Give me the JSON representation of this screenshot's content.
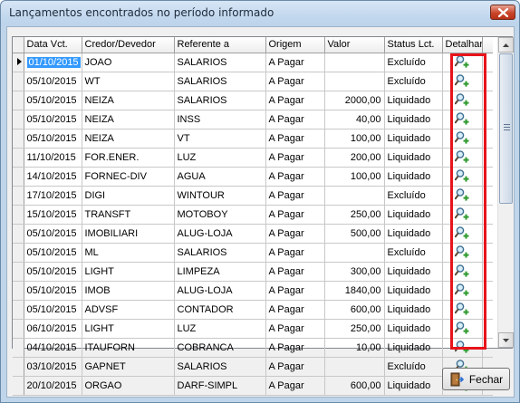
{
  "window": {
    "title": "Lançamentos encontrados no período informado",
    "close_icon": "close-icon"
  },
  "grid": {
    "columns": [
      "Data Vct.",
      "Credor/Devedor",
      "Referente a",
      "Origem",
      "Valor",
      "Status Lct.",
      "Detalhar"
    ],
    "detail_icon": "magnifier-plus-icon",
    "rows": [
      {
        "date": "01/10/2015",
        "creditor": "JOAO",
        "reference": "SALARIOS",
        "origin": "A Pagar",
        "value": "",
        "status": "Excluído"
      },
      {
        "date": "05/10/2015",
        "creditor": "WT",
        "reference": "SALARIOS",
        "origin": "A Pagar",
        "value": "",
        "status": "Excluído"
      },
      {
        "date": "05/10/2015",
        "creditor": "NEIZA",
        "reference": "SALARIOS",
        "origin": "A Pagar",
        "value": "2000,00",
        "status": "Liquidado"
      },
      {
        "date": "05/10/2015",
        "creditor": "NEIZA",
        "reference": "INSS",
        "origin": "A Pagar",
        "value": "40,00",
        "status": "Liquidado"
      },
      {
        "date": "05/10/2015",
        "creditor": "NEIZA",
        "reference": "VT",
        "origin": "A Pagar",
        "value": "100,00",
        "status": "Liquidado"
      },
      {
        "date": "11/10/2015",
        "creditor": "FOR.ENER.",
        "reference": "LUZ",
        "origin": "A Pagar",
        "value": "200,00",
        "status": "Liquidado"
      },
      {
        "date": "14/10/2015",
        "creditor": "FORNEC-DIV",
        "reference": "AGUA",
        "origin": "A Pagar",
        "value": "100,00",
        "status": "Liquidado"
      },
      {
        "date": "17/10/2015",
        "creditor": "DIGI",
        "reference": "WINTOUR",
        "origin": "A Pagar",
        "value": "",
        "status": "Excluído"
      },
      {
        "date": "15/10/2015",
        "creditor": "TRANSFT",
        "reference": "MOTOBOY",
        "origin": "A Pagar",
        "value": "250,00",
        "status": "Liquidado"
      },
      {
        "date": "05/10/2015",
        "creditor": "IMOBILIARI",
        "reference": "ALUG-LOJA",
        "origin": "A Pagar",
        "value": "500,00",
        "status": "Liquidado"
      },
      {
        "date": "05/10/2015",
        "creditor": "ML",
        "reference": "SALARIOS",
        "origin": "A Pagar",
        "value": "",
        "status": "Excluído"
      },
      {
        "date": "05/10/2015",
        "creditor": "LIGHT",
        "reference": "LIMPEZA",
        "origin": "A Pagar",
        "value": "300,00",
        "status": "Liquidado"
      },
      {
        "date": "05/10/2015",
        "creditor": "IMOB",
        "reference": "ALUG-LOJA",
        "origin": "A Pagar",
        "value": "1840,00",
        "status": "Liquidado"
      },
      {
        "date": "05/10/2015",
        "creditor": "ADVSF",
        "reference": "CONTADOR",
        "origin": "A Pagar",
        "value": "600,00",
        "status": "Liquidado"
      },
      {
        "date": "06/10/2015",
        "creditor": "LIGHT",
        "reference": "LUZ",
        "origin": "A Pagar",
        "value": "250,00",
        "status": "Liquidado"
      },
      {
        "date": "04/10/2015",
        "creditor": "ITAUFORN",
        "reference": "COBRANCA",
        "origin": "A Pagar",
        "value": "10,00",
        "status": "Liquidado"
      },
      {
        "date": "03/10/2015",
        "creditor": "GAPNET",
        "reference": "SALARIOS",
        "origin": "A Pagar",
        "value": "",
        "status": "Excluído"
      },
      {
        "date": "20/10/2015",
        "creditor": "ORGAO",
        "reference": "DARF-SIMPL",
        "origin": "A Pagar",
        "value": "600,00",
        "status": "Liquidado"
      }
    ]
  },
  "footer": {
    "close_label": "Fechar",
    "close_icon": "door-exit-icon"
  },
  "colors": {
    "selection": "#3399ff",
    "highlight_box": "#e8141b"
  }
}
